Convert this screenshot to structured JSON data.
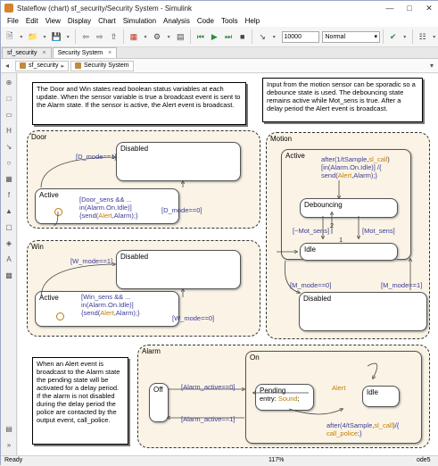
{
  "window": {
    "title": "Stateflow (chart) sf_security/Security System - Simulink"
  },
  "menu": [
    "File",
    "Edit",
    "View",
    "Display",
    "Chart",
    "Simulation",
    "Analysis",
    "Code",
    "Tools",
    "Help"
  ],
  "toolbar": {
    "stop_time": "10000",
    "sim_mode": "Normal"
  },
  "tabs": [
    {
      "label": "sf_security"
    },
    {
      "label": "Security System"
    }
  ],
  "breadcrumb": [
    "sf_security",
    "Security System"
  ],
  "status": {
    "left": "Ready",
    "zoom": "117%",
    "solver": "ode5"
  },
  "notes": {
    "door_win": "The Door and Win states read boolean status variables at each update.  When the sensor variable is true a broadcast event is sent to the Alarm state.  If the sensor is active, the Alert event is broadcast.",
    "motion": "Input from the motion sensor can be sporadic so a debounce state is used.  The debouncing state remains active while Mot_sens is true. After a delay period the Alert event is broadcast.",
    "alarm": "When an Alert event is broadcast to the Alarm state the pending state will be activated for a delay period.  If the alarm is not disabled during the delay period the police are contacted by the output event, call_police."
  },
  "door": {
    "label": "Door",
    "disabled": "Disabled",
    "active": "Active",
    "t_disable": "[D_mode==1]",
    "t_enable": "[D_mode==0]",
    "action_1": "[Door_sens && ...",
    "action_2": "in(Alarm.On.Idle)]",
    "action_3_pre": "{send(",
    "action_3_ev": "Alert",
    "action_3_post": ",Alarm);}"
  },
  "win": {
    "label": "Win",
    "disabled": "Disabled",
    "active": "Active",
    "t_disable": "[W_mode==1]",
    "t_enable": "[W_mode==0]",
    "action_1": "[Win_sens && ...",
    "action_2": "in(Alarm.On.Idle)]",
    "action_3_pre": "{send(",
    "action_3_ev": "Alert",
    "action_3_post": ",Alarm);}"
  },
  "motion": {
    "label": "Motion",
    "active": "Active",
    "debouncing": "Debouncing",
    "idle": "Idle",
    "disabled": "Disabled",
    "after_1_pre": "after(1/tSample,",
    "after_1_ev": "sl_call",
    "after_1_post": ")",
    "after_2": "[in(Alarm.On.Idle)] /{",
    "after_3_pre": "send(",
    "after_3_ev": "Alert",
    "after_3_post": ",Alarm);}",
    "t_not_sens": "[~Mot_sens]",
    "t_sens": "[Mot_sens]",
    "prio_2": "2",
    "prio_1": "1",
    "t_m0": "[M_mode==0]",
    "t_m1": "[M_mode==1]"
  },
  "alarm": {
    "label": "Alarm",
    "off": "Off",
    "on": "On",
    "pending": "Pending",
    "pending_entry_pre": "entry: ",
    "pending_entry_ev": "Sound",
    "pending_entry_post": ";",
    "idle": "Idle",
    "alert": "Alert",
    "t_active0": "[Alarm_active==0]",
    "t_active1": "[Alarm_active==1]",
    "after_1_pre": "after(4/tSample,",
    "after_1_ev": "sl_call",
    "after_1_post": ")/{",
    "after_2_ev": "call_police",
    "after_2_post": ";}"
  }
}
